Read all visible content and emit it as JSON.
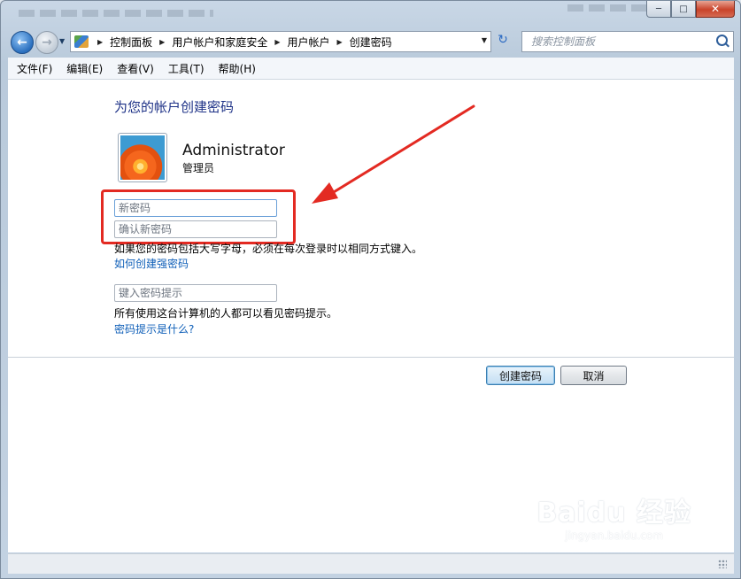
{
  "window": {
    "controls": {
      "minimize_icon": "minimize-icon",
      "maximize_icon": "maximize-icon",
      "close_icon": "close-icon"
    }
  },
  "navigation": {
    "breadcrumb": [
      "控制面板",
      "用户帐户和家庭安全",
      "用户帐户",
      "创建密码"
    ],
    "search_placeholder": "搜索控制面板"
  },
  "menu": [
    "文件(F)",
    "编辑(E)",
    "查看(V)",
    "工具(T)",
    "帮助(H)"
  ],
  "page": {
    "heading": "为您的帐户创建密码",
    "user": {
      "name": "Administrator",
      "role": "管理员"
    },
    "fields": {
      "new_password_placeholder": "新密码",
      "confirm_password_placeholder": "确认新密码",
      "hint_placeholder": "键入密码提示"
    },
    "case_note": "如果您的密码包括大写字母，必须在每次登录时以相同方式键入。",
    "strong_password_link": "如何创建强密码",
    "hint_note": "所有使用这台计算机的人都可以看见密码提示。",
    "hint_link": "密码提示是什么?",
    "buttons": {
      "create": "创建密码",
      "cancel": "取消"
    }
  },
  "watermark": {
    "main": "Baidu 经验",
    "sub": "jingyan.baidu.com"
  },
  "annotation": {
    "highlight_color": "#e32a22"
  }
}
